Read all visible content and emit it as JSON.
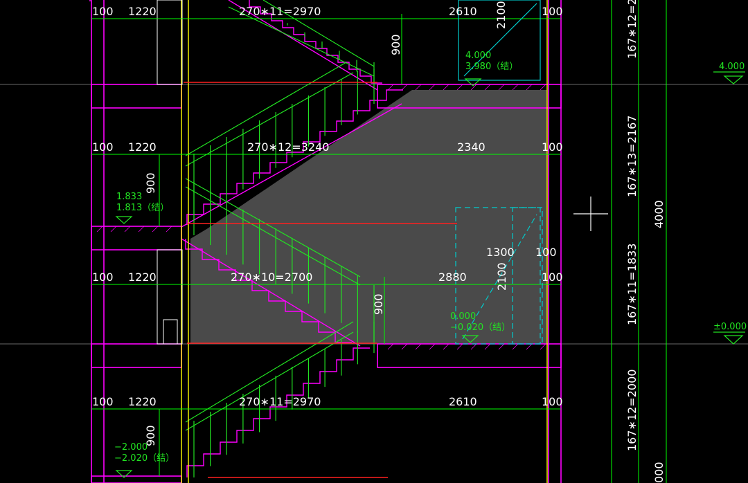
{
  "drawing": {
    "colors": {
      "background": "#000000",
      "dimension_line": "#00ff00",
      "wall_outline": "#ff00ff",
      "fill_gray": "#4a4a4a",
      "rail": "#ffff00",
      "red_line": "#ff0000",
      "window": "#00cccc",
      "text_white": "#ffffff",
      "text_green": "#22e322",
      "axis_gray": "#777777"
    },
    "rows": [
      {
        "left": "100",
        "landing": "1220",
        "flight": "270∗11=2970",
        "space": "2610",
        "right": "100"
      },
      {
        "left": "100",
        "landing": "1220",
        "flight": "270∗12=3240",
        "space": "2340",
        "right": "100"
      },
      {
        "left": "100",
        "landing": "1220",
        "flight": "270∗10=2700",
        "space": "2880",
        "right": "100"
      },
      {
        "left": "100",
        "landing": "1220",
        "flight": "270∗11=2970",
        "space": "2610",
        "right": "100"
      }
    ],
    "railing_heights": [
      "900",
      "900",
      "900",
      "900"
    ],
    "window_heights": [
      "2100",
      "2100"
    ],
    "window_width": "1300",
    "window_side": "100",
    "level_labels": [
      {
        "top": "4.000",
        "bottom": "3.980（结）"
      },
      {
        "top": "1.833",
        "bottom": "1.813（结）"
      },
      {
        "top": "0.000",
        "bottom": "−0.020（结）"
      },
      {
        "top": "−2.000",
        "bottom": "−2.020（结）"
      }
    ],
    "right_dims": [
      "167∗12=2...",
      "167∗13=2167",
      "4000",
      "167∗11=1833",
      "167∗12=2000",
      "000"
    ],
    "elevation_marks": [
      "4.000",
      "±0.000"
    ]
  }
}
